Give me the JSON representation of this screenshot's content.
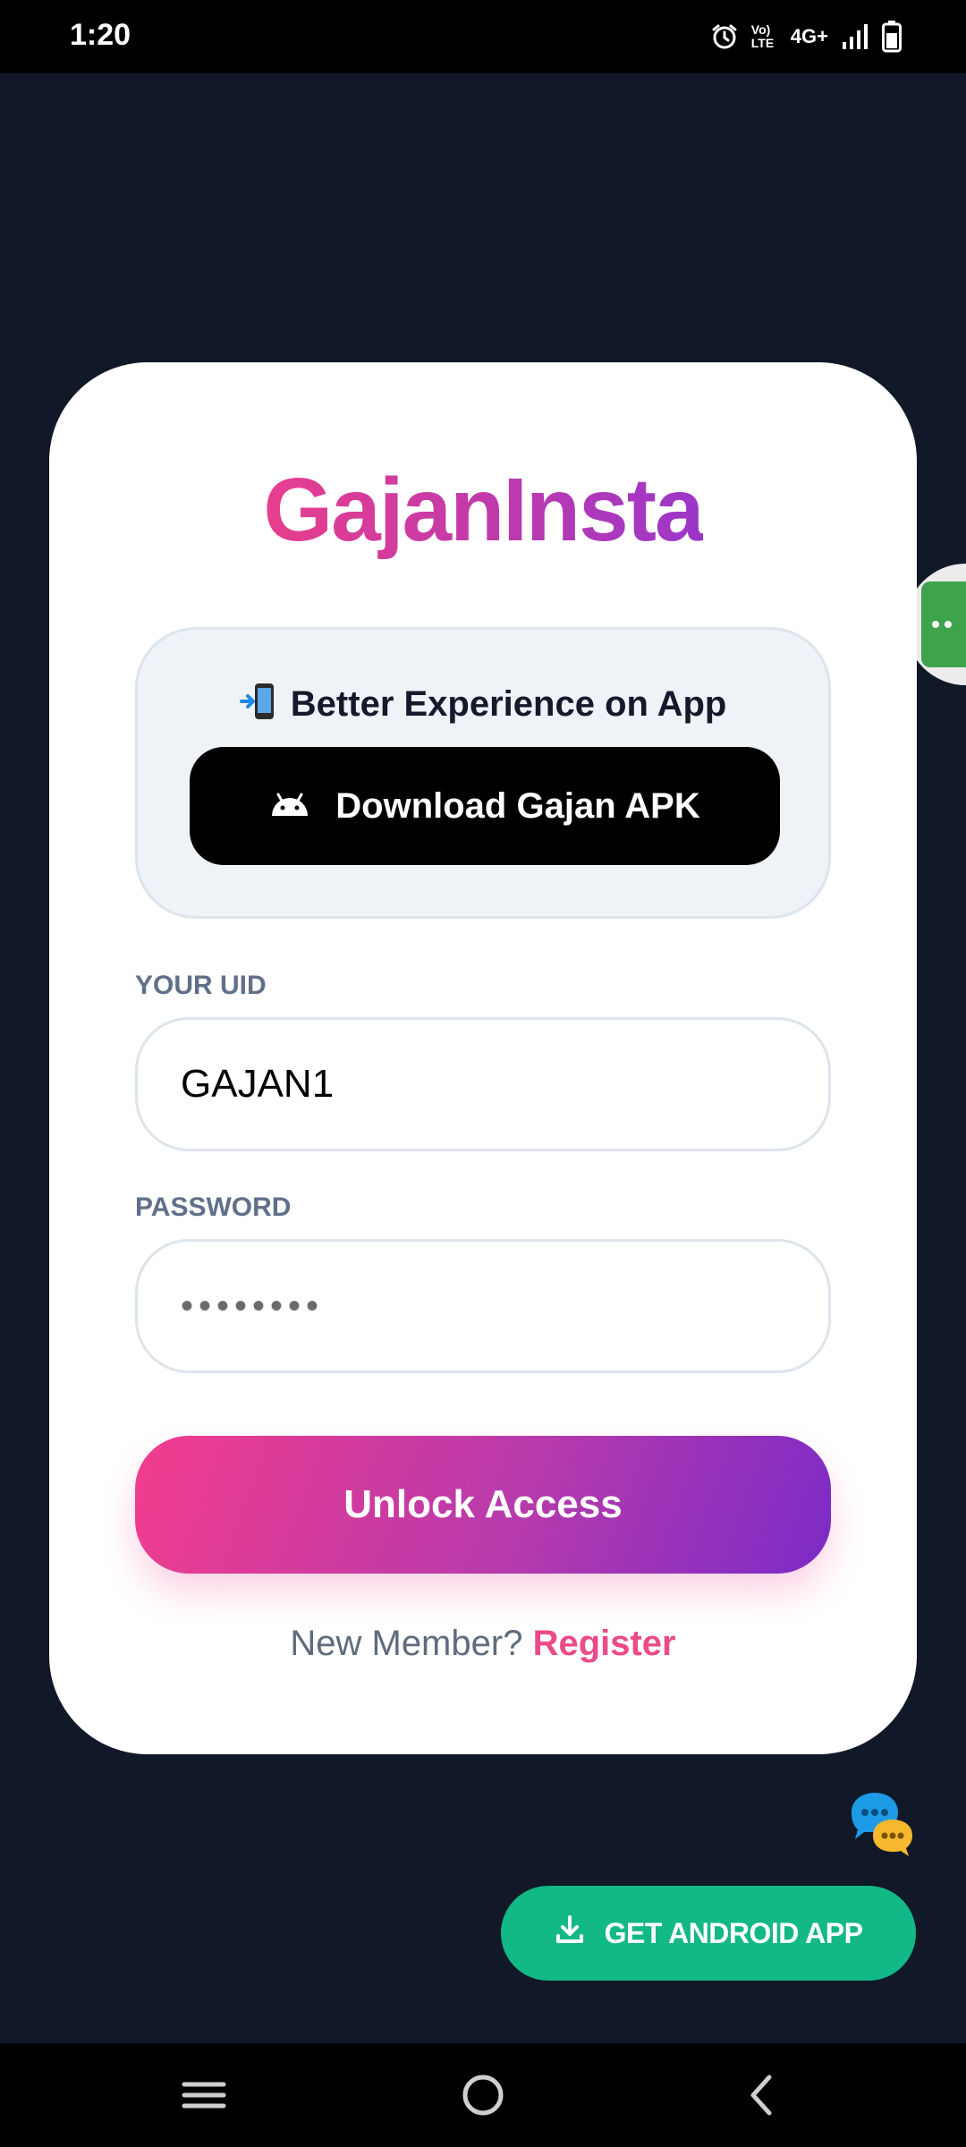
{
  "status_bar": {
    "time": "1:20",
    "network": "4G+",
    "volte": "Vo) LTE"
  },
  "app": {
    "brand": "GajanInsta",
    "brand_gradient": [
      "#e83e8c",
      "#9b36c9"
    ]
  },
  "promo": {
    "title": "Better Experience on App",
    "download_label": "Download Gajan APK"
  },
  "form": {
    "uid_label": "YOUR UID",
    "uid_value": "GAJAN1",
    "password_label": "PASSWORD",
    "password_value": "••••••••",
    "submit_label": "Unlock Access",
    "register_prompt": "New Member?",
    "register_link": "Register"
  },
  "floating": {
    "android_app_label": "GET ANDROID APP"
  },
  "colors": {
    "background": "#111827",
    "accent_pink": "#ec4a8a",
    "android_green": "#12b886",
    "side_tab_green": "#3fa34d"
  },
  "icons": {
    "alarm": "alarm-icon",
    "signal": "signal-icon",
    "battery": "battery-icon",
    "android": "android-icon",
    "phone": "mobile-phone-arrow-icon",
    "download": "download-icon",
    "chat": "chat-bubbles-icon"
  }
}
